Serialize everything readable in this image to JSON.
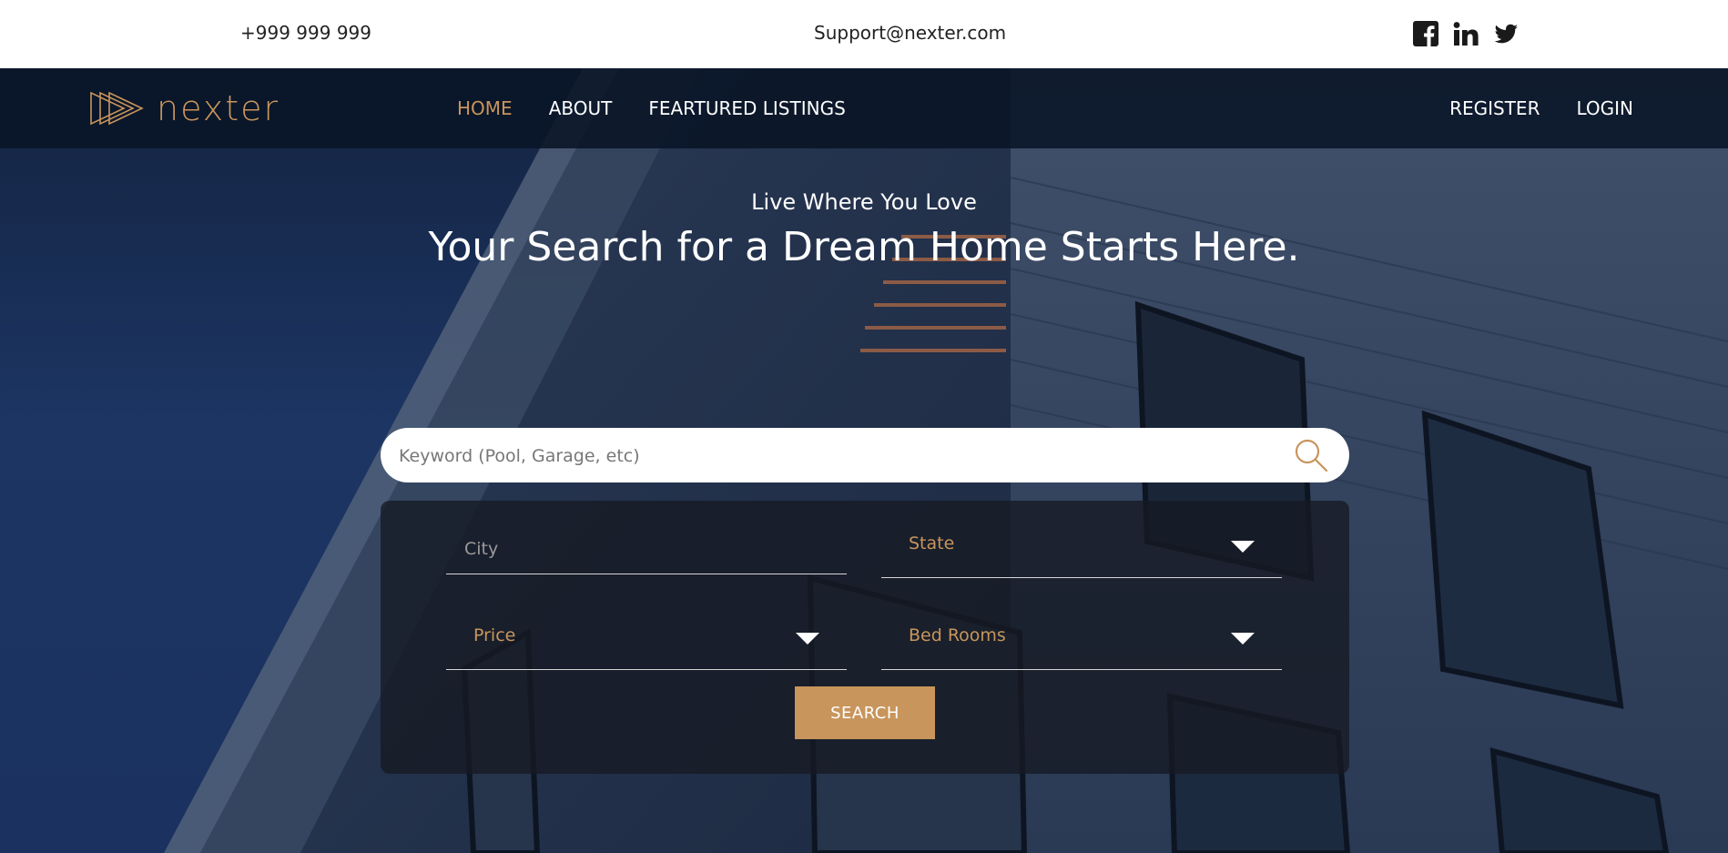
{
  "topbar": {
    "phone": "+999 999 999",
    "email": "Support@nexter.com",
    "socials": [
      "facebook-icon",
      "linkedin-icon",
      "twitter-icon"
    ]
  },
  "nav": {
    "logo_text": "nexter",
    "links": [
      {
        "label": "HOME",
        "active": true
      },
      {
        "label": "ABOUT",
        "active": false
      },
      {
        "label": "FEARTURED LISTINGS",
        "active": false
      }
    ],
    "right": [
      "REGISTER",
      "LOGIN"
    ]
  },
  "hero": {
    "tagline": "Live Where You Love",
    "headline": "Your Search for a Dream Home Starts Here."
  },
  "search": {
    "keyword_placeholder": "Keyword (Pool, Garage, etc)",
    "city_placeholder": "City",
    "state_label": "State",
    "price_label": "Price",
    "bedrooms_label": "Bed Rooms",
    "button_label": "SEARCH"
  },
  "colors": {
    "accent": "#c8955c",
    "nav_bg": "#091426",
    "hero_blue": "#1c3563",
    "panel_bg": "#161a22"
  }
}
